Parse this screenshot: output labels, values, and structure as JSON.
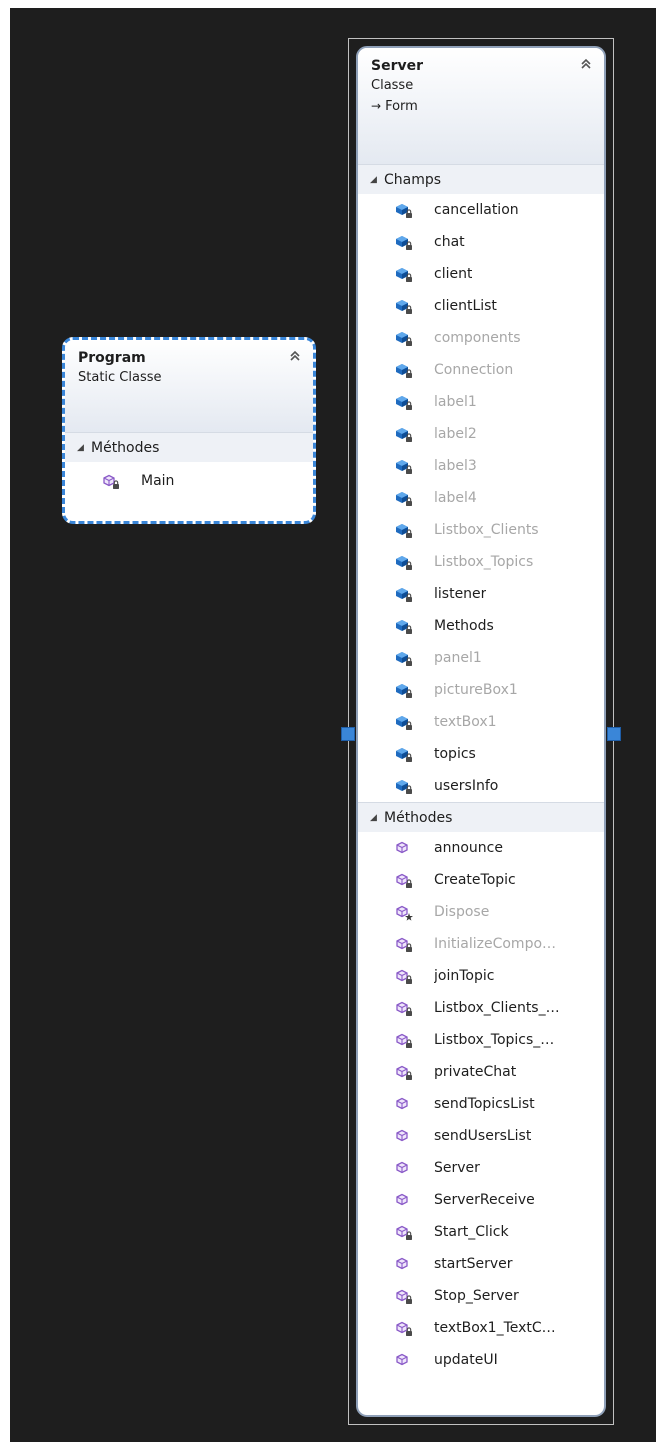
{
  "program": {
    "name": "Program",
    "kind": "Static Classe",
    "compartments": [
      {
        "title": "Méthodes",
        "members": [
          {
            "label": "Main",
            "type": "method",
            "private": true,
            "grayed": false
          }
        ]
      }
    ]
  },
  "server": {
    "name": "Server",
    "kind": "Classe",
    "base": "Form",
    "compartments": [
      {
        "title": "Champs",
        "members": [
          {
            "label": "cancellation",
            "type": "field",
            "grayed": false
          },
          {
            "label": "chat",
            "type": "field",
            "grayed": false
          },
          {
            "label": "client",
            "type": "field",
            "grayed": false
          },
          {
            "label": "clientList",
            "type": "field",
            "grayed": false
          },
          {
            "label": "components",
            "type": "field",
            "grayed": true
          },
          {
            "label": "Connection",
            "type": "field",
            "grayed": true
          },
          {
            "label": "label1",
            "type": "field",
            "grayed": true
          },
          {
            "label": "label2",
            "type": "field",
            "grayed": true
          },
          {
            "label": "label3",
            "type": "field",
            "grayed": true
          },
          {
            "label": "label4",
            "type": "field",
            "grayed": true
          },
          {
            "label": "Listbox_Clients",
            "type": "field",
            "grayed": true
          },
          {
            "label": "Listbox_Topics",
            "type": "field",
            "grayed": true
          },
          {
            "label": "listener",
            "type": "field",
            "grayed": false
          },
          {
            "label": "Methods",
            "type": "field",
            "grayed": false
          },
          {
            "label": "panel1",
            "type": "field",
            "grayed": true
          },
          {
            "label": "pictureBox1",
            "type": "field",
            "grayed": true
          },
          {
            "label": "textBox1",
            "type": "field",
            "grayed": true
          },
          {
            "label": "topics",
            "type": "field",
            "grayed": false
          },
          {
            "label": "usersInfo",
            "type": "field",
            "grayed": false
          }
        ]
      },
      {
        "title": "Méthodes",
        "members": [
          {
            "label": "announce",
            "type": "method",
            "overlay": "none",
            "grayed": false
          },
          {
            "label": "CreateTopic",
            "type": "method",
            "overlay": "lock",
            "grayed": false
          },
          {
            "label": "Dispose",
            "type": "method",
            "overlay": "star",
            "grayed": true
          },
          {
            "label": "InitializeCompo…",
            "type": "method",
            "overlay": "lock",
            "grayed": true
          },
          {
            "label": "joinTopic",
            "type": "method",
            "overlay": "lock",
            "grayed": false
          },
          {
            "label": "Listbox_Clients_…",
            "type": "method",
            "overlay": "lock",
            "grayed": false
          },
          {
            "label": "Listbox_Topics_…",
            "type": "method",
            "overlay": "lock",
            "grayed": false
          },
          {
            "label": "privateChat",
            "type": "method",
            "overlay": "lock",
            "grayed": false
          },
          {
            "label": "sendTopicsList",
            "type": "method",
            "overlay": "none",
            "grayed": false
          },
          {
            "label": "sendUsersList",
            "type": "method",
            "overlay": "none",
            "grayed": false
          },
          {
            "label": "Server",
            "type": "method",
            "overlay": "none",
            "grayed": false
          },
          {
            "label": "ServerReceive",
            "type": "method",
            "overlay": "none",
            "grayed": false
          },
          {
            "label": "Start_Click",
            "type": "method",
            "overlay": "lock",
            "grayed": false
          },
          {
            "label": "startServer",
            "type": "method",
            "overlay": "none",
            "grayed": false
          },
          {
            "label": "Stop_Server",
            "type": "method",
            "overlay": "lock",
            "grayed": false
          },
          {
            "label": "textBox1_TextC…",
            "type": "method",
            "overlay": "lock",
            "grayed": false
          },
          {
            "label": "updateUI",
            "type": "method",
            "overlay": "none",
            "grayed": false
          }
        ]
      }
    ]
  },
  "icons": {
    "field": "field-cube-icon",
    "method": "method-cube-icon",
    "lock": "lock-overlay-icon",
    "star": "star-overlay-icon",
    "collapse": "double-chevron-up-icon",
    "expanded": "triangle-expanded-icon"
  },
  "colors": {
    "canvas": "#1e1e1e",
    "selection": "#3a86d8",
    "field_icon": "#1f6bbf",
    "method_icon": "#8a5ac8",
    "grayed_text": "#a7a7a7"
  }
}
